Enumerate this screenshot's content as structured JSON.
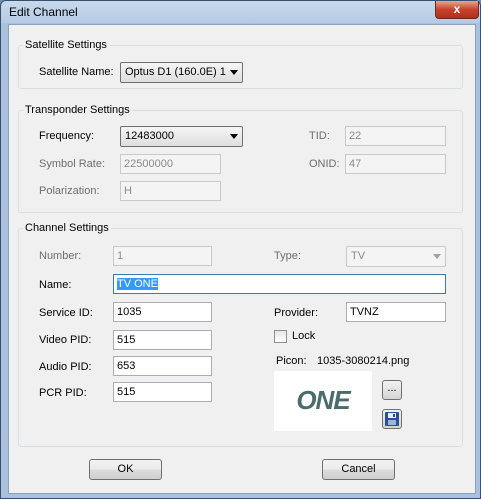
{
  "window": {
    "title": "Edit Channel",
    "close_glyph": "x"
  },
  "satellite": {
    "section_title": "Satellite Settings",
    "name_label": "Satellite Name:",
    "name_value": "Optus D1 (160.0E) 1"
  },
  "transponder": {
    "section_title": "Transponder Settings",
    "frequency_label": "Frequency:",
    "frequency_value": "12483000",
    "symbol_rate_label": "Symbol Rate:",
    "symbol_rate_value": "22500000",
    "polarization_label": "Polarization:",
    "polarization_value": "H",
    "tid_label": "TID:",
    "tid_value": "22",
    "onid_label": "ONID:",
    "onid_value": "47"
  },
  "channel": {
    "section_title": "Channel Settings",
    "number_label": "Number:",
    "number_value": "1",
    "type_label": "Type:",
    "type_value": "TV",
    "name_label": "Name:",
    "name_value": "TV ONE",
    "service_id_label": "Service ID:",
    "service_id_value": "1035",
    "provider_label": "Provider:",
    "provider_value": "TVNZ",
    "video_pid_label": "Video PID:",
    "video_pid_value": "515",
    "lock_label": "Lock",
    "audio_pid_label": "Audio PID:",
    "audio_pid_value": "653",
    "picon_label": "Picon:",
    "picon_filename": "1035-3080214.png",
    "picon_logo_text": "ONE",
    "browse_label": "...",
    "pcr_pid_label": "PCR PID:",
    "pcr_pid_value": "515"
  },
  "buttons": {
    "ok": "OK",
    "cancel": "Cancel"
  },
  "icons": {
    "save": "floppy-disk-icon",
    "close": "close-icon"
  },
  "colors": {
    "accent": "#3399ff",
    "logo": "#4a6d6c",
    "close": "#c7422c"
  }
}
